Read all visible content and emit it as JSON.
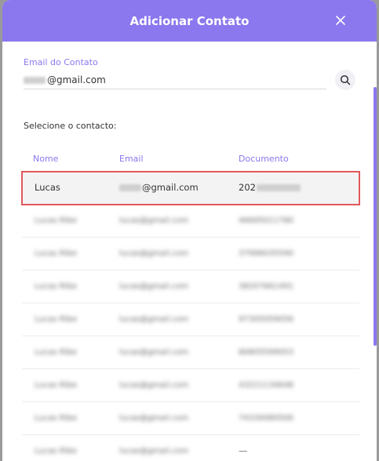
{
  "header": {
    "title": "Adicionar Contato"
  },
  "form": {
    "email_label": "Email do Contato",
    "email_suffix": "@gmail.com",
    "select_label": "Selecione o contacto:"
  },
  "table": {
    "columns": [
      "Nome",
      "Email",
      "Documento"
    ],
    "selected_row": {
      "name": "Lucas",
      "email_suffix": "@gmail.com",
      "doc_prefix": "202"
    },
    "rows": [
      {
        "name": "Lucas Ribe",
        "email": "lucas@gmail.com",
        "doc": "46695011780"
      },
      {
        "name": "Lucas Ribe",
        "email": "lucas@gmail.com",
        "doc": "37996035590"
      },
      {
        "name": "Lucas Ribe",
        "email": "lucas@gmail.com",
        "doc": "38207661491"
      },
      {
        "name": "Lucas Ribe",
        "email": "lucas@gmail.com",
        "doc": "97305059056"
      },
      {
        "name": "Lucas Ribe",
        "email": "lucas@gmail.com",
        "doc": "80805599053"
      },
      {
        "name": "Lucas Ribe",
        "email": "lucas@gmail.com",
        "doc": "43221134648"
      },
      {
        "name": "Lucas Ribe",
        "email": "lucas@gmail.com",
        "doc": "74330080506"
      },
      {
        "name": "Lucas Ribe",
        "email": "lucas@gmail.com",
        "doc": "—"
      }
    ]
  },
  "colors": {
    "accent": "#8b77ee",
    "selection_border": "#e1585a"
  },
  "icons": {
    "close": "close-icon",
    "search": "search-icon"
  }
}
